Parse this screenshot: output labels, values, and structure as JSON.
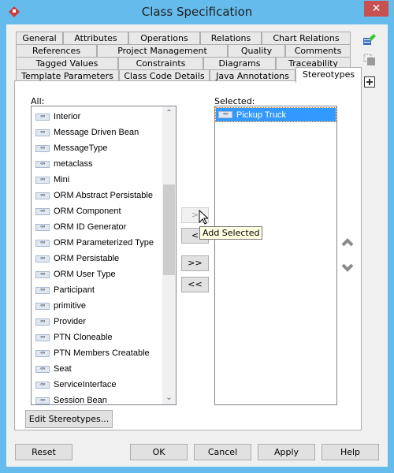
{
  "window": {
    "title": "Class Specification",
    "close_label": "✕"
  },
  "tabs": {
    "row1": [
      "General",
      "Attributes",
      "Operations",
      "Relations",
      "Chart Relations"
    ],
    "row2": [
      "References",
      "Project Management",
      "Quality",
      "Comments"
    ],
    "row3": [
      "Tagged Values",
      "Constraints",
      "Diagrams",
      "Traceability"
    ],
    "row4": [
      "Template Parameters",
      "Class Code Details",
      "Java Annotations",
      "Stereotypes"
    ],
    "active": "Stereotypes"
  },
  "side_toolbar": {
    "icons": [
      "edit-model-icon",
      "duplicate-icon",
      "add-icon"
    ]
  },
  "stereotypes": {
    "all_label": "All:",
    "selected_label": "Selected:",
    "icon_text": "«»",
    "all_items": [
      "Interior",
      "Message Driven Bean",
      "MessageType",
      "metaclass",
      "Mini",
      "ORM Abstract Persistable",
      "ORM Component",
      "ORM ID Generator",
      "ORM Parameterized Type",
      "ORM Persistable",
      "ORM User Type",
      "Participant",
      "primitive",
      "Provider",
      "PTN Cloneable",
      "PTN Members Creatable",
      "Seat",
      "ServiceInterface",
      "Session Bean"
    ],
    "selected_items": [
      "Pickup Truck"
    ],
    "scroll_position_fraction": 0.36,
    "buttons": {
      "add": ">",
      "remove": "<",
      "add_all": ">>",
      "remove_all": "<<"
    },
    "tooltip": "Add Selected",
    "edit_button": "Edit Stereotypes..."
  },
  "footer": {
    "reset": "Reset",
    "ok": "OK",
    "cancel": "Cancel",
    "apply": "Apply",
    "help": "Help"
  },
  "colors": {
    "title_bar": "#65bcec",
    "close_button": "#c75050",
    "selection": "#3399ff",
    "tooltip_bg": "#ffffe1"
  }
}
